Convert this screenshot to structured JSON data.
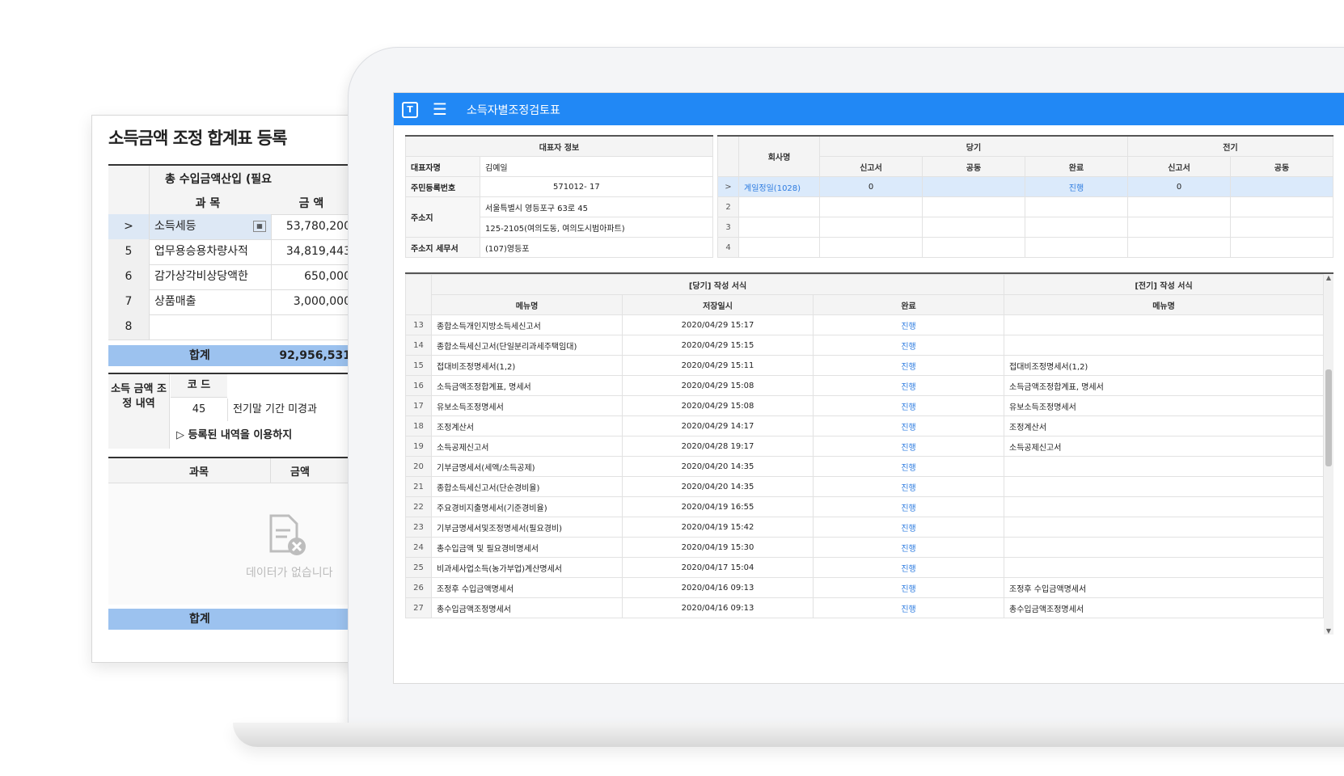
{
  "back_panel": {
    "title": "소득금액 조정 합계표 등록",
    "section_title": "총 수입금액산입 (필요",
    "col_subject": "과 목",
    "col_amount": "금 액",
    "rows": [
      {
        "no": ">",
        "subject": "소득세등",
        "amount": "53,780,200"
      },
      {
        "no": "5",
        "subject": "업무용승용차량사적",
        "amount": "34,819,443"
      },
      {
        "no": "6",
        "subject": "감가상각비상당액한",
        "amount": "650,000"
      },
      {
        "no": "7",
        "subject": "상품매출",
        "amount": "3,000,000"
      },
      {
        "no": "8",
        "subject": "",
        "amount": ""
      }
    ],
    "total_label": "합계",
    "total_amount": "92,956,531",
    "adj_label": "소득 금액 조정 내역",
    "code_label": "코 드",
    "code_value": "45",
    "code_desc": "전기말 기간 미경과",
    "registered_note": "▷ 등록된 내역을 이용하지",
    "col_subject2": "과목",
    "col_amount2": "금액",
    "empty_text": "데이터가 없습니다",
    "total_label2": "합계"
  },
  "window": {
    "app_icon": "T",
    "menu_icon": "☰",
    "title": "소득자별조정검토표"
  },
  "info": {
    "header": "대표자 정보",
    "rows": [
      {
        "label": "대표자명",
        "value": "김예일"
      },
      {
        "label": "주민등록번호",
        "value": "571012-  17"
      },
      {
        "label": "주소지",
        "value": "서울특별시 영등포구 63로 45"
      },
      {
        "label": "",
        "value": "125-2105(여의도동, 여의도시범아파트)"
      },
      {
        "label": "주소지 세무서",
        "value": "(107)영등포"
      }
    ]
  },
  "company": {
    "col_name": "회사명",
    "group_current": "당기",
    "group_prior": "전기",
    "cols": [
      "신고서",
      "공동",
      "완료",
      "신고서",
      "공동"
    ],
    "rows": [
      {
        "no": ">",
        "name": "계일정일(1028)",
        "c1": "0",
        "c2": "",
        "c3": "진행",
        "c4": "0",
        "c5": ""
      },
      {
        "no": "2",
        "name": "",
        "c1": "",
        "c2": "",
        "c3": "",
        "c4": "",
        "c5": ""
      },
      {
        "no": "3",
        "name": "",
        "c1": "",
        "c2": "",
        "c3": "",
        "c4": "",
        "c5": ""
      },
      {
        "no": "4",
        "name": "",
        "c1": "",
        "c2": "",
        "c3": "",
        "c4": "",
        "c5": ""
      }
    ]
  },
  "forms": {
    "group_current": "[당기] 작성 서식",
    "group_prior": "[전기] 작성 서식",
    "col_menu": "메뉴명",
    "col_saved": "저장일시",
    "col_done": "완료",
    "col_menu_prior": "메뉴명",
    "rows": [
      {
        "no": "13",
        "menu": "종합소득개인지방소득세신고서",
        "saved": "2020/04/29 15:17",
        "done": "진행",
        "prior": ""
      },
      {
        "no": "14",
        "menu": "종합소득세신고서(단일분리과세주택임대)",
        "saved": "2020/04/29 15:15",
        "done": "진행",
        "prior": ""
      },
      {
        "no": "15",
        "menu": "접대비조정명세서(1,2)",
        "saved": "2020/04/29 15:11",
        "done": "진행",
        "prior": "접대비조정명세서(1,2)"
      },
      {
        "no": "16",
        "menu": "소득금액조정합계표, 명세서",
        "saved": "2020/04/29 15:08",
        "done": "진행",
        "prior": "소득금액조정합계표, 명세서"
      },
      {
        "no": "17",
        "menu": "유보소득조정명세서",
        "saved": "2020/04/29 15:08",
        "done": "진행",
        "prior": "유보소득조정명세서"
      },
      {
        "no": "18",
        "menu": "조정계산서",
        "saved": "2020/04/29 14:17",
        "done": "진행",
        "prior": "조정계산서"
      },
      {
        "no": "19",
        "menu": "소득공제신고서",
        "saved": "2020/04/28 19:17",
        "done": "진행",
        "prior": "소득공제신고서"
      },
      {
        "no": "20",
        "menu": "기부금명세서(세액/소득공제)",
        "saved": "2020/04/20 14:35",
        "done": "진행",
        "prior": ""
      },
      {
        "no": "21",
        "menu": "종합소득세신고서(단순경비율)",
        "saved": "2020/04/20 14:35",
        "done": "진행",
        "prior": ""
      },
      {
        "no": "22",
        "menu": "주요경비지출명세서(기준경비율)",
        "saved": "2020/04/19 16:55",
        "done": "진행",
        "prior": ""
      },
      {
        "no": "23",
        "menu": "기부금명세서및조정명세서(필요경비)",
        "saved": "2020/04/19 15:42",
        "done": "진행",
        "prior": ""
      },
      {
        "no": "24",
        "menu": "총수입금액 및 필요경비명세서",
        "saved": "2020/04/19 15:30",
        "done": "진행",
        "prior": ""
      },
      {
        "no": "25",
        "menu": "비과세사업소득(농가부업)계산명세서",
        "saved": "2020/04/17 15:04",
        "done": "진행",
        "prior": ""
      },
      {
        "no": "26",
        "menu": "조정후 수입금액명세서",
        "saved": "2020/04/16 09:13",
        "done": "진행",
        "prior": "조정후 수입금액명세서"
      },
      {
        "no": "27",
        "menu": "총수입금액조정명세서",
        "saved": "2020/04/16 09:13",
        "done": "진행",
        "prior": "총수입금액조정명세서"
      }
    ]
  },
  "colors": {
    "accent": "#2188f5",
    "total_bar": "#9cc2ef",
    "link": "#2e7ce0"
  }
}
